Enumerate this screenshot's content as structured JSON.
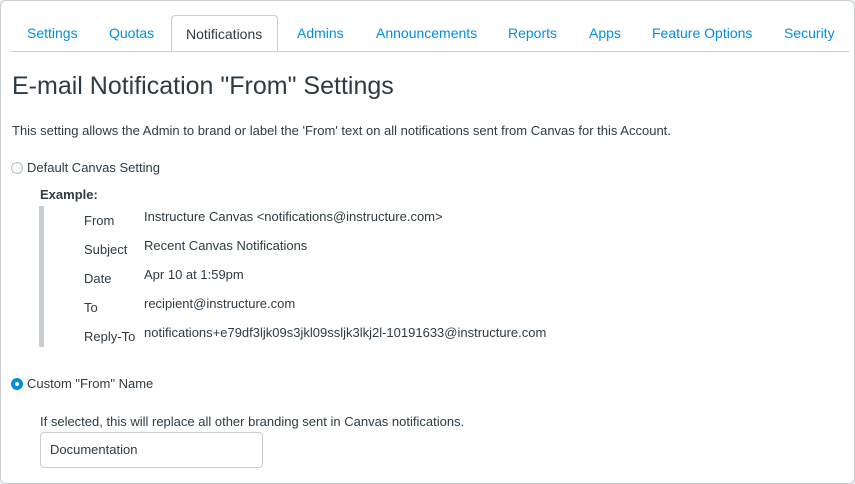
{
  "tabs": [
    {
      "label": "Settings",
      "active": false
    },
    {
      "label": "Quotas",
      "active": false
    },
    {
      "label": "Notifications",
      "active": true
    },
    {
      "label": "Admins",
      "active": false
    },
    {
      "label": "Announcements",
      "active": false
    },
    {
      "label": "Reports",
      "active": false
    },
    {
      "label": "Apps",
      "active": false
    },
    {
      "label": "Feature Options",
      "active": false
    },
    {
      "label": "Security",
      "active": false
    }
  ],
  "page": {
    "title": "E-mail Notification \"From\" Settings",
    "description": "This setting allows the Admin to brand or label the 'From' text on all notifications sent from Canvas for this Account."
  },
  "options": {
    "default": {
      "label": "Default Canvas Setting",
      "checked": false
    },
    "custom": {
      "label": "Custom \"From\" Name",
      "checked": true
    }
  },
  "example": {
    "label": "Example:",
    "rows": [
      {
        "key": "From",
        "value": "Instructure Canvas <notifications@instructure.com>"
      },
      {
        "key": "Subject",
        "value": "Recent Canvas Notifications"
      },
      {
        "key": "Date",
        "value": "Apr 10 at 1:59pm"
      },
      {
        "key": "To",
        "value": "recipient@instructure.com"
      },
      {
        "key": "Reply-To",
        "value": "notifications+e79df3ljk09s3jkl09ssljk3lkj2l-10191633@instructure.com"
      }
    ]
  },
  "custom_name": {
    "note": "If selected, this will replace all other branding sent in Canvas notifications.",
    "value": "Documentation"
  },
  "colors": {
    "accent": "#008ee2",
    "text": "#2d3b45",
    "border": "#c7cdd1"
  }
}
